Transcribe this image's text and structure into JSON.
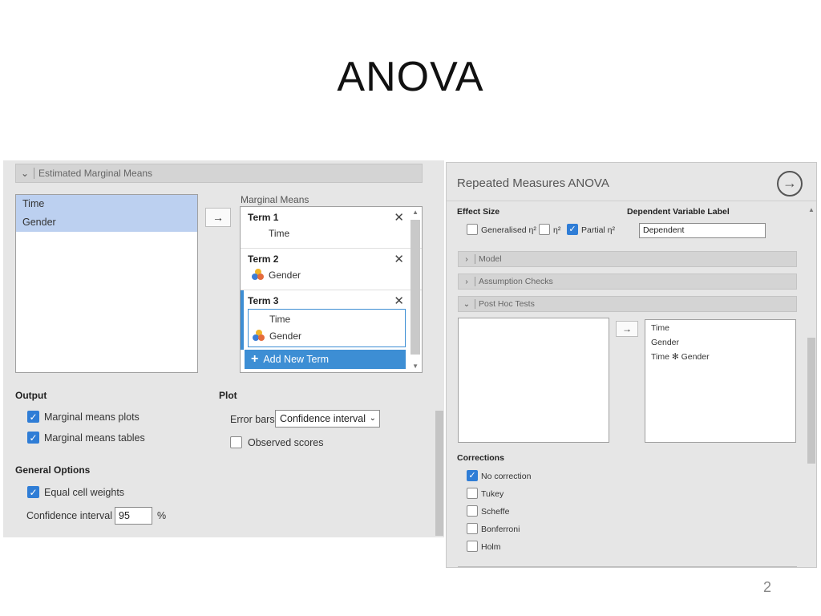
{
  "slide": {
    "title": "ANOVA",
    "page_number": "2"
  },
  "left": {
    "section_header": "Estimated Marginal Means",
    "variables": [
      "Time",
      "Gender"
    ],
    "arrow": "→",
    "marginal_means_label": "Marginal Means",
    "terms": [
      {
        "title": "Term 1",
        "vars": [
          "Time"
        ]
      },
      {
        "title": "Term 2",
        "vars": [
          "Gender"
        ]
      },
      {
        "title": "Term 3",
        "vars": [
          "Time",
          "Gender"
        ]
      }
    ],
    "add_term_label": "Add New Term",
    "output": {
      "heading": "Output",
      "marginal_means_plots": {
        "label": "Marginal means plots",
        "checked": true
      },
      "marginal_means_tables": {
        "label": "Marginal means tables",
        "checked": true
      }
    },
    "plot": {
      "heading": "Plot",
      "error_bars_label": "Error bars",
      "error_bars_value": "Confidence interval",
      "observed_scores": {
        "label": "Observed scores",
        "checked": false
      }
    },
    "general_options": {
      "heading": "General Options",
      "equal_cell_weights": {
        "label": "Equal cell weights",
        "checked": true
      },
      "confidence_interval_label": "Confidence interval",
      "confidence_interval_value": "95",
      "percent": "%"
    }
  },
  "right": {
    "title": "Repeated Measures ANOVA",
    "go_icon": "→",
    "effect_size_label": "Effect Size",
    "effect_size_options": [
      {
        "label": "Generalised η²",
        "checked": false
      },
      {
        "label": "η²",
        "checked": false
      },
      {
        "label": "Partial η²",
        "checked": true
      }
    ],
    "dependent_label_heading": "Dependent Variable Label",
    "dependent_label_value": "Dependent",
    "sections": [
      "Model",
      "Assumption Checks",
      "Post Hoc Tests"
    ],
    "arrow": "→",
    "post_hoc_terms": [
      "Time",
      "Gender",
      "Time ✻ Gender"
    ],
    "corrections_label": "Corrections",
    "corrections": [
      {
        "label": "No correction",
        "checked": true
      },
      {
        "label": "Tukey",
        "checked": false
      },
      {
        "label": "Scheffe",
        "checked": false
      },
      {
        "label": "Bonferroni",
        "checked": false
      },
      {
        "label": "Holm",
        "checked": false
      }
    ]
  },
  "colors": {
    "accent": "#3d8ed4",
    "checkbox": "#2f7dd6",
    "selection": "#bcd0f0",
    "panel_bg": "#e6e6e6"
  }
}
